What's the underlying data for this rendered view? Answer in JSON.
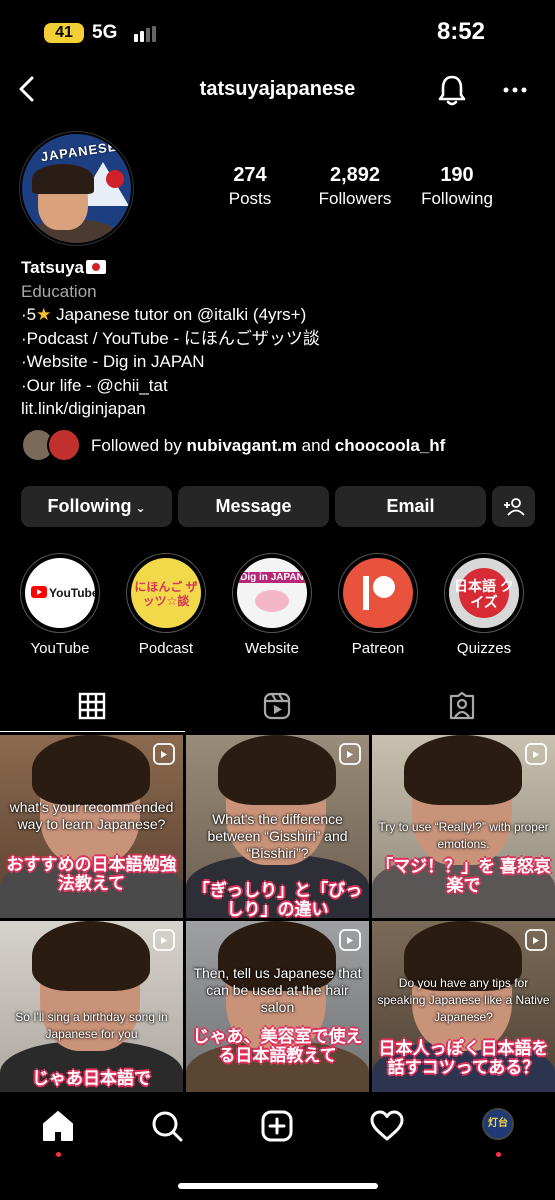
{
  "status_bar": {
    "battery": "41",
    "network": "5G",
    "time": "8:52"
  },
  "header": {
    "username": "tatsuyajapanese"
  },
  "stats": [
    {
      "value": "274",
      "label": "Posts"
    },
    {
      "value": "2,892",
      "label": "Followers"
    },
    {
      "value": "190",
      "label": "Following"
    }
  ],
  "bio": {
    "name": "Tatsuya",
    "category": "Education",
    "line1_pre": "·5",
    "line1_post": " Japanese tutor on @italki (4yrs+)",
    "line2": "·Podcast / YouTube - にほんごザッツ談",
    "line3": "·Website - Dig in JAPAN",
    "line4": "·Our life - @chii_tat",
    "link": "lit.link/diginjapan"
  },
  "avatar_text": "JAPANESE",
  "followed_by": {
    "prefix": "Followed by ",
    "user1": "nubivagant.m",
    "sep": " and ",
    "user2": "choocoola_hf"
  },
  "buttons": {
    "following": "Following",
    "message": "Message",
    "email": "Email"
  },
  "highlights": [
    {
      "label": "YouTube",
      "icon": "youtube-logo"
    },
    {
      "label": "Podcast",
      "icon": "podcast-cover",
      "cover_text": "にほんご ザッツ☆談"
    },
    {
      "label": "Website",
      "icon": "website-cover",
      "cover_text": "Dig in JAPAN"
    },
    {
      "label": "Patreon",
      "icon": "patreon-logo"
    },
    {
      "label": "Quizzes",
      "icon": "quiz-cover",
      "cover_text": "日本語 クイズ"
    }
  ],
  "highlight_youtube_text": "YouTube",
  "posts": [
    {
      "en": "what's your recommended way to learn Japanese?",
      "jp": "おすすめの日本語勉強法教えて"
    },
    {
      "en": "What's the difference between “Gisshiri” and “Bisshiri”?",
      "jp": "「ぎっしり」と「びっしり」の違い"
    },
    {
      "en": "Try to use “Really!?” with proper emotions.",
      "jp": "「マジ！？」を 喜怒哀楽で"
    },
    {
      "en": "So I'll sing a birthday song in Japanese for you",
      "jp": "じゃあ日本語で"
    },
    {
      "en": "Then, tell us Japanese that can be used at the hair salon",
      "jp": "じゃあ、美容室で使える日本語教えて"
    },
    {
      "en": "Do you have any tips for speaking Japanese like a Native Japanese?",
      "jp": "日本人っぽく日本語を話すコツってある？"
    }
  ],
  "nav_avatar_text": "灯台",
  "colors": {
    "background": "#000000",
    "button": "#262626",
    "accent_red": "#ff3040",
    "battery": "#f2cf35"
  }
}
